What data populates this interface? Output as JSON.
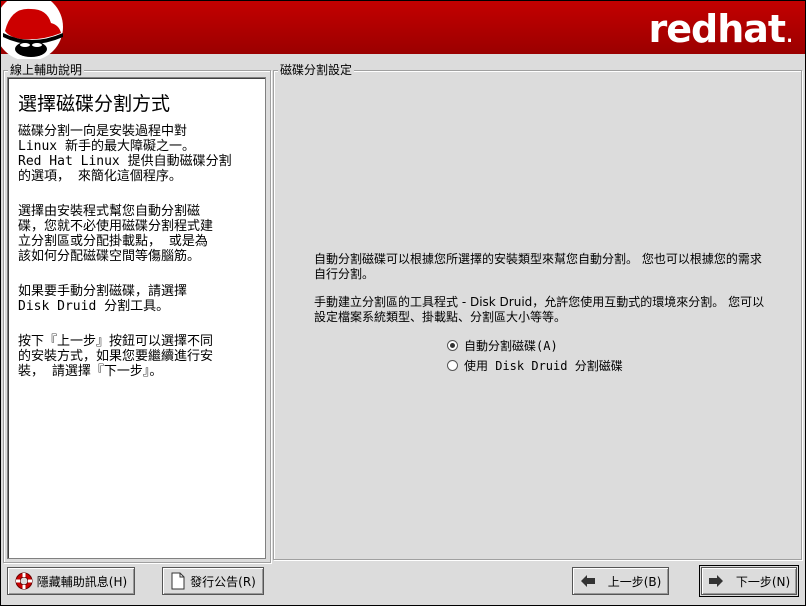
{
  "header": {
    "brand_main": "redhat",
    "brand_dot": "."
  },
  "help": {
    "group_title": "線上輔助說明",
    "title": "選擇磁碟分割方式",
    "paragraphs": [
      "磁碟分割一向是安裝過程中對\nLinux 新手的最大障礙之一。\nRed Hat Linux 提供自動磁碟分割\n的選項， 來簡化這個程序。",
      "選擇由安裝程式幫您自動分割磁\n碟，您就不必使用磁碟分割程式建\n立分割區或分配掛載點， 或是為\n該如何分配磁碟空間等傷腦筋。",
      "如果要手動分割磁碟，請選擇\nDisk Druid 分割工具。",
      "按下『上一步』按鈕可以選擇不同\n的安裝方式，如果您要繼續進行安\n裝， 請選擇『下一步』。"
    ]
  },
  "main": {
    "group_title": "磁碟分割設定",
    "desc1": "自動分割磁碟可以根據您所選擇的安裝類型來幫您自動分割。 您也可以根據您的需求自行分割。",
    "desc2": "手動建立分割區的工具程式 - Disk Druid，允許您使用互動式的環境來分割。 您可以設定檔案系統類型、掛載點、分割區大小等等。",
    "options": [
      {
        "label": "自動分割磁碟(A)",
        "selected": true
      },
      {
        "label": "使用 Disk Druid 分割磁碟",
        "selected": false
      }
    ]
  },
  "buttons": {
    "hide_help": "隱藏輔助訊息(H)",
    "release_notes": "發行公告(R)",
    "back": "上一步(B)",
    "next": "下一步(N)"
  },
  "colors": {
    "banner": "#b00000",
    "background": "#dcdcdc"
  }
}
